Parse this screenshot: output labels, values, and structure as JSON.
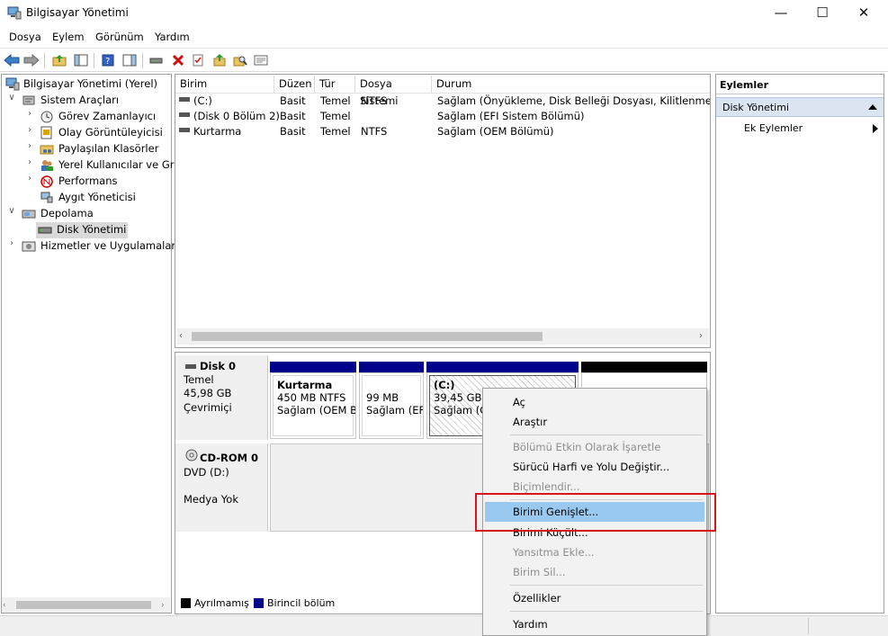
{
  "window": {
    "title": "Bilgisayar Yönetimi",
    "minimize": "—",
    "maximize": "☐",
    "close": "✕"
  },
  "menu": [
    "Dosya",
    "Eylem",
    "Görünüm",
    "Yardım"
  ],
  "tree": {
    "root": "Bilgisayar Yönetimi (Yerel)",
    "system_tools": "Sistem Araçları",
    "task_scheduler": "Görev Zamanlayıcı",
    "event_viewer": "Olay Görüntüleyicisi",
    "shared_folders": "Paylaşılan Klasörler",
    "local_users": "Yerel Kullanıcılar ve Gru",
    "performance": "Performans",
    "device_manager": "Aygıt Yöneticisi",
    "storage": "Depolama",
    "disk_management": "Disk Yönetimi",
    "services": "Hizmetler ve Uygulamalar"
  },
  "volume_list": {
    "columns": [
      "Birim",
      "Düzen",
      "Tür",
      "Dosya Sistemi",
      "Durum"
    ],
    "rows": [
      {
        "volume": "(C:)",
        "layout": "Basit",
        "type": "Temel",
        "fs": "NTFS",
        "status": "Sağlam (Önyükleme, Disk Belleği Dosyası, Kilitlenme Bilgi"
      },
      {
        "volume": "(Disk 0 Bölüm 2)",
        "layout": "Basit",
        "type": "Temel",
        "fs": "",
        "status": "Sağlam (EFI Sistem Bölümü)"
      },
      {
        "volume": "Kurtarma",
        "layout": "Basit",
        "type": "Temel",
        "fs": "NTFS",
        "status": "Sağlam (OEM Bölümü)"
      }
    ]
  },
  "disks": {
    "disk0": {
      "name": "Disk 0",
      "type": "Temel",
      "size": "45,98 GB",
      "state": "Çevrimiçi"
    },
    "cdrom0": {
      "name": "CD-ROM 0",
      "type": "DVD (D:)",
      "state": "Medya Yok"
    }
  },
  "partitions": {
    "recovery": {
      "name": "Kurtarma",
      "size": "450 MB NTFS",
      "status": "Sağlam (OEM B"
    },
    "efi": {
      "size": "99 MB",
      "status": "Sağlam (EF"
    },
    "c": {
      "name": "(C:)",
      "size": "39,45 GB N",
      "status": "Sağlam (Ö"
    }
  },
  "legend": {
    "unallocated": "Ayrılmamış",
    "primary": "Birincil bölüm"
  },
  "actions": {
    "header": "Eylemler",
    "section": "Disk Yönetimi",
    "more": "Ek Eylemler"
  },
  "context_menu": {
    "open": "Aç",
    "explore": "Araştır",
    "mark_active": "Bölümü Etkin Olarak İşaretle",
    "change_letter": "Sürücü Harfi ve Yolu Değiştir...",
    "format": "Biçimlendir...",
    "extend": "Birimi Genişlet...",
    "shrink": "Birimi Küçült...",
    "add_mirror": "Yansıtma Ekle...",
    "delete": "Birim Sil...",
    "properties": "Özellikler",
    "help": "Yardım"
  },
  "colors": {
    "primary_partition": "#00008b",
    "unallocated": "#000000",
    "highlight_box": "#d9161c",
    "menu_selected": "#99c9ef"
  }
}
